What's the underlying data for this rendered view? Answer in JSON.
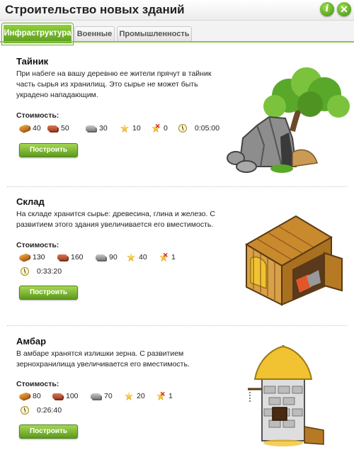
{
  "window": {
    "title": "Строительство новых зданий",
    "info_label": "i",
    "close_label": "✕"
  },
  "tabs": [
    {
      "label": "Инфраструктура",
      "active": true
    },
    {
      "label": "Военные",
      "active": false
    },
    {
      "label": "Промышленность",
      "active": false
    }
  ],
  "cost_label": "Стоимость:",
  "build_label": "Построить",
  "buildings": [
    {
      "name": "Тайник",
      "description": "При набеге на вашу деревню ее жители прячут в тайник часть сырья из хранилищ. Это сырье не может быть украдено нападающим.",
      "cost": {
        "wood": "40",
        "clay": "50",
        "iron": "30",
        "crop": "10",
        "crop_upkeep": "0",
        "time": "0:05:00"
      }
    },
    {
      "name": "Склад",
      "description": "На складе хранится сырье: древесина, глина и железо. С развитием этого здания увеличивается его вместимость.",
      "cost": {
        "wood": "130",
        "clay": "160",
        "iron": "90",
        "crop": "40",
        "crop_upkeep": "1",
        "time": "0:33:20"
      }
    },
    {
      "name": "Амбар",
      "description": "В амбаре хранятся излишки зерна. С развитием зернохранилища увеличивается его вместимость.",
      "cost": {
        "wood": "80",
        "clay": "100",
        "iron": "70",
        "crop": "20",
        "crop_upkeep": "1",
        "time": "0:26:40"
      }
    }
  ],
  "icons": {
    "wood": "wood-icon",
    "clay": "clay-icon",
    "iron": "iron-icon",
    "crop": "crop-icon",
    "crop_upkeep": "crop-consumption-icon",
    "time": "clock-icon"
  },
  "colors": {
    "accent": "#6fb02a",
    "button": "#5d9a1d"
  }
}
